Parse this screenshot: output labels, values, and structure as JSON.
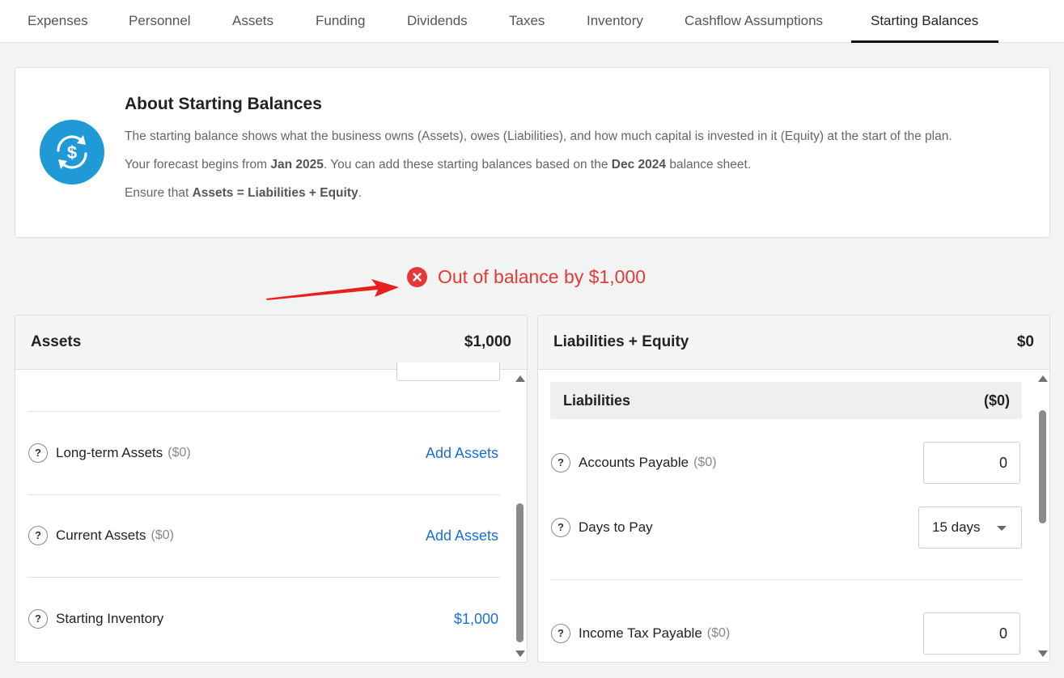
{
  "tabs": [
    {
      "label": "Expenses",
      "active": false
    },
    {
      "label": "Personnel",
      "active": false
    },
    {
      "label": "Assets",
      "active": false
    },
    {
      "label": "Funding",
      "active": false
    },
    {
      "label": "Dividends",
      "active": false
    },
    {
      "label": "Taxes",
      "active": false
    },
    {
      "label": "Inventory",
      "active": false
    },
    {
      "label": "Cashflow Assumptions",
      "active": false
    },
    {
      "label": "Starting Balances",
      "active": true
    }
  ],
  "about": {
    "title": "About Starting Balances",
    "icon": "dollar-refresh-icon",
    "line1": "The starting balance shows what the business owns (Assets), owes (Liabilities), and how much capital is invested in it (Equity) at the start of the plan.",
    "line2_a": "Your forecast begins from ",
    "line2_b": "Jan 2025",
    "line2_c": ". You can add these starting balances based on the ",
    "line2_d": "Dec 2024",
    "line2_e": " balance sheet.",
    "line3_a": "Ensure that ",
    "line3_b": "Assets = Liabilities + Equity",
    "line3_c": "."
  },
  "status": {
    "text": "Out of balance by $1,000",
    "color": "#e53935",
    "icon": "error-circle-icon"
  },
  "assets_panel": {
    "title": "Assets",
    "total": "$1,000",
    "rows": [
      {
        "label": "Long-term Assets",
        "amount": "($0)",
        "action": "Add Assets"
      },
      {
        "label": "Current Assets",
        "amount": "($0)",
        "action": "Add Assets"
      },
      {
        "label": "Starting Inventory",
        "amount": "",
        "action": "$1,000"
      }
    ]
  },
  "liab_panel": {
    "title": "Liabilities + Equity",
    "total": "$0",
    "section_title": "Liabilities",
    "section_total": "($0)",
    "accounts_payable": {
      "label": "Accounts Payable",
      "amount": "($0)",
      "value": "0"
    },
    "days_to_pay": {
      "label": "Days to Pay",
      "value": "15 days"
    },
    "income_tax": {
      "label": "Income Tax Payable",
      "amount": "($0)",
      "value": "0"
    }
  },
  "colors": {
    "accent": "#1f9ad6",
    "link": "#1a6fd6",
    "error": "#e53935",
    "arrow": "#e8201c"
  }
}
